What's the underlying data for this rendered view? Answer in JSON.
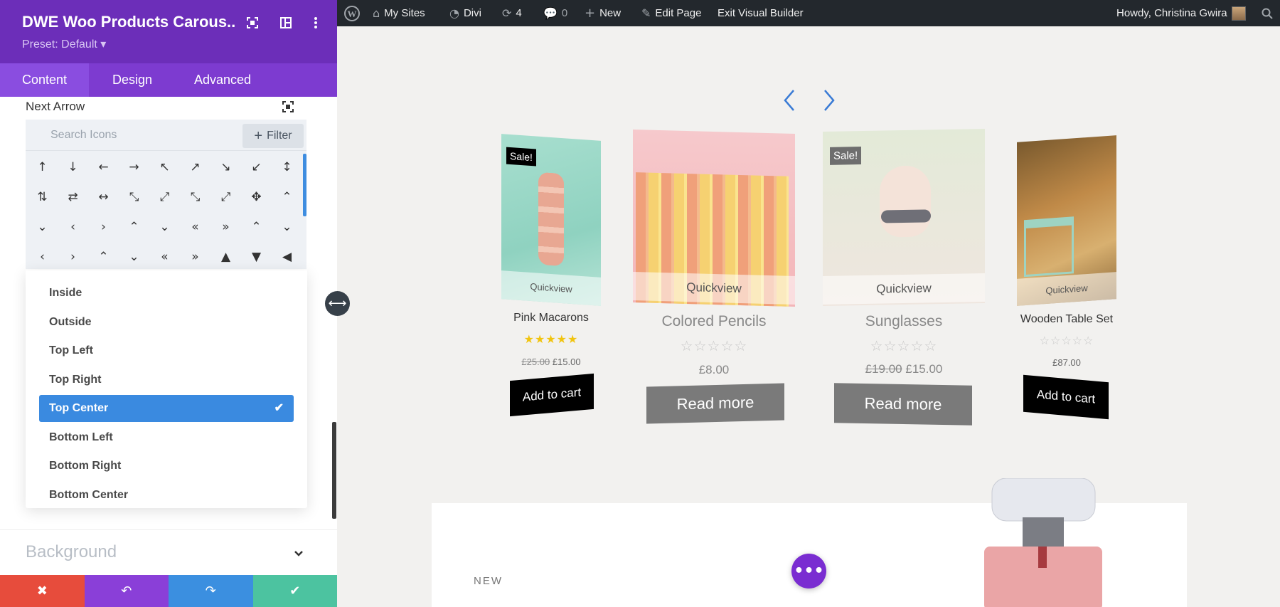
{
  "panel": {
    "title": "DWE Woo Products Carous...",
    "preset": "Preset: Default ▾",
    "tabs": [
      {
        "label": "Content",
        "active": true
      },
      {
        "label": "Design",
        "active": false
      },
      {
        "label": "Advanced",
        "active": false
      }
    ],
    "next_arrow_label": "Next Arrow",
    "search_placeholder": "Search Icons",
    "filter_label": "Filter",
    "icons": [
      "↑",
      "↓",
      "←",
      "→",
      "↖",
      "↗",
      "↘",
      "↙",
      "↕",
      "⇅",
      "⇄",
      "↔",
      "⤡",
      "⤢",
      "⤡",
      "⤢",
      "✥",
      "⌃",
      "⌄",
      "‹",
      "›",
      "⌃",
      "⌄",
      "«",
      "»",
      "⌃",
      "⌄",
      "‹",
      "›",
      "⌃",
      "⌄",
      "«",
      "»",
      "▲",
      "▼",
      "◀"
    ],
    "dropdown_options": [
      {
        "label": "Inside",
        "selected": false
      },
      {
        "label": "Outside",
        "selected": false
      },
      {
        "label": "Top Left",
        "selected": false
      },
      {
        "label": "Top Right",
        "selected": false
      },
      {
        "label": "Top Center",
        "selected": true
      },
      {
        "label": "Bottom Left",
        "selected": false
      },
      {
        "label": "Bottom Right",
        "selected": false
      },
      {
        "label": "Bottom Center",
        "selected": false
      }
    ],
    "background_label": "Background",
    "actions": {
      "discard": "✖",
      "undo": "↶",
      "redo": "↷",
      "save": "✔"
    },
    "colors": {
      "header": "#6c2eb9",
      "tabs": "#7d3bd0",
      "discard": "#e74c3c",
      "undo": "#8a3fd8",
      "redo": "#3b8fe0",
      "save": "#4cc3a0"
    }
  },
  "admin_bar": {
    "my_sites": "My Sites",
    "divi": "Divi",
    "updates_count": "4",
    "comments_count": "0",
    "new": "New",
    "edit_page": "Edit Page",
    "exit_builder": "Exit Visual Builder",
    "howdy": "Howdy, Christina Gwira"
  },
  "products": [
    {
      "name": "Pink Macarons",
      "sale": "Sale!",
      "quickview": "Quickview",
      "old_price": "£25.00",
      "price": "£15.00",
      "rating": 5,
      "button": "Add to cart",
      "button_type": "cart"
    },
    {
      "name": "Colored Pencils",
      "quickview": "Quickview",
      "price": "£8.00",
      "rating": 0,
      "button": "Read more",
      "button_type": "more"
    },
    {
      "name": "Sunglasses",
      "sale": "Sale!",
      "quickview": "Quickview",
      "old_price": "£19.00",
      "price": "£15.00",
      "rating": 0,
      "button": "Read more",
      "button_type": "more"
    },
    {
      "name": "Wooden Table Set",
      "quickview": "Quickview",
      "price": "£87.00",
      "rating": 0,
      "button": "Add to cart",
      "button_type": "cart"
    }
  ],
  "promo": {
    "tag": "NEW"
  },
  "fab": "•••"
}
